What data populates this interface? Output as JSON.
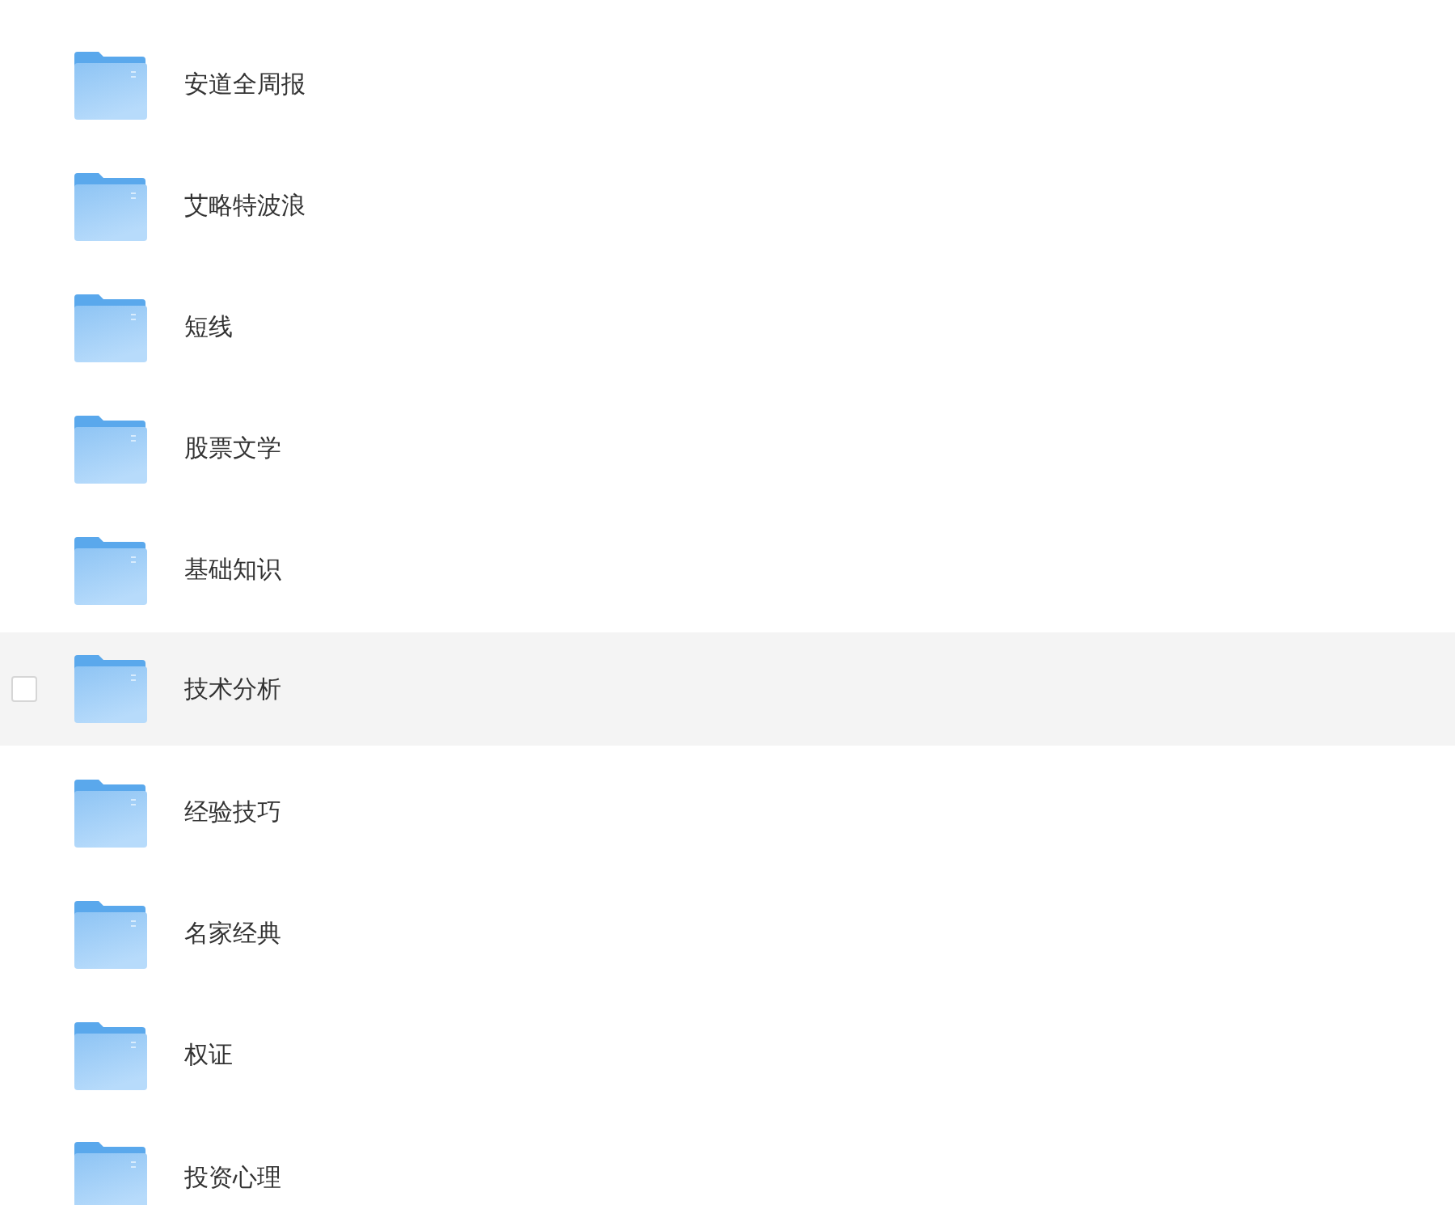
{
  "folders": [
    {
      "name": "安道全周报",
      "hovered": false,
      "checked": false
    },
    {
      "name": "艾略特波浪",
      "hovered": false,
      "checked": false
    },
    {
      "name": "短线",
      "hovered": false,
      "checked": false
    },
    {
      "name": "股票文学",
      "hovered": false,
      "checked": false
    },
    {
      "name": "基础知识",
      "hovered": false,
      "checked": false
    },
    {
      "name": "技术分析",
      "hovered": true,
      "checked": false
    },
    {
      "name": "经验技巧",
      "hovered": false,
      "checked": false
    },
    {
      "name": "名家经典",
      "hovered": false,
      "checked": false
    },
    {
      "name": "权证",
      "hovered": false,
      "checked": false
    },
    {
      "name": "投资心理",
      "hovered": false,
      "checked": false
    }
  ]
}
